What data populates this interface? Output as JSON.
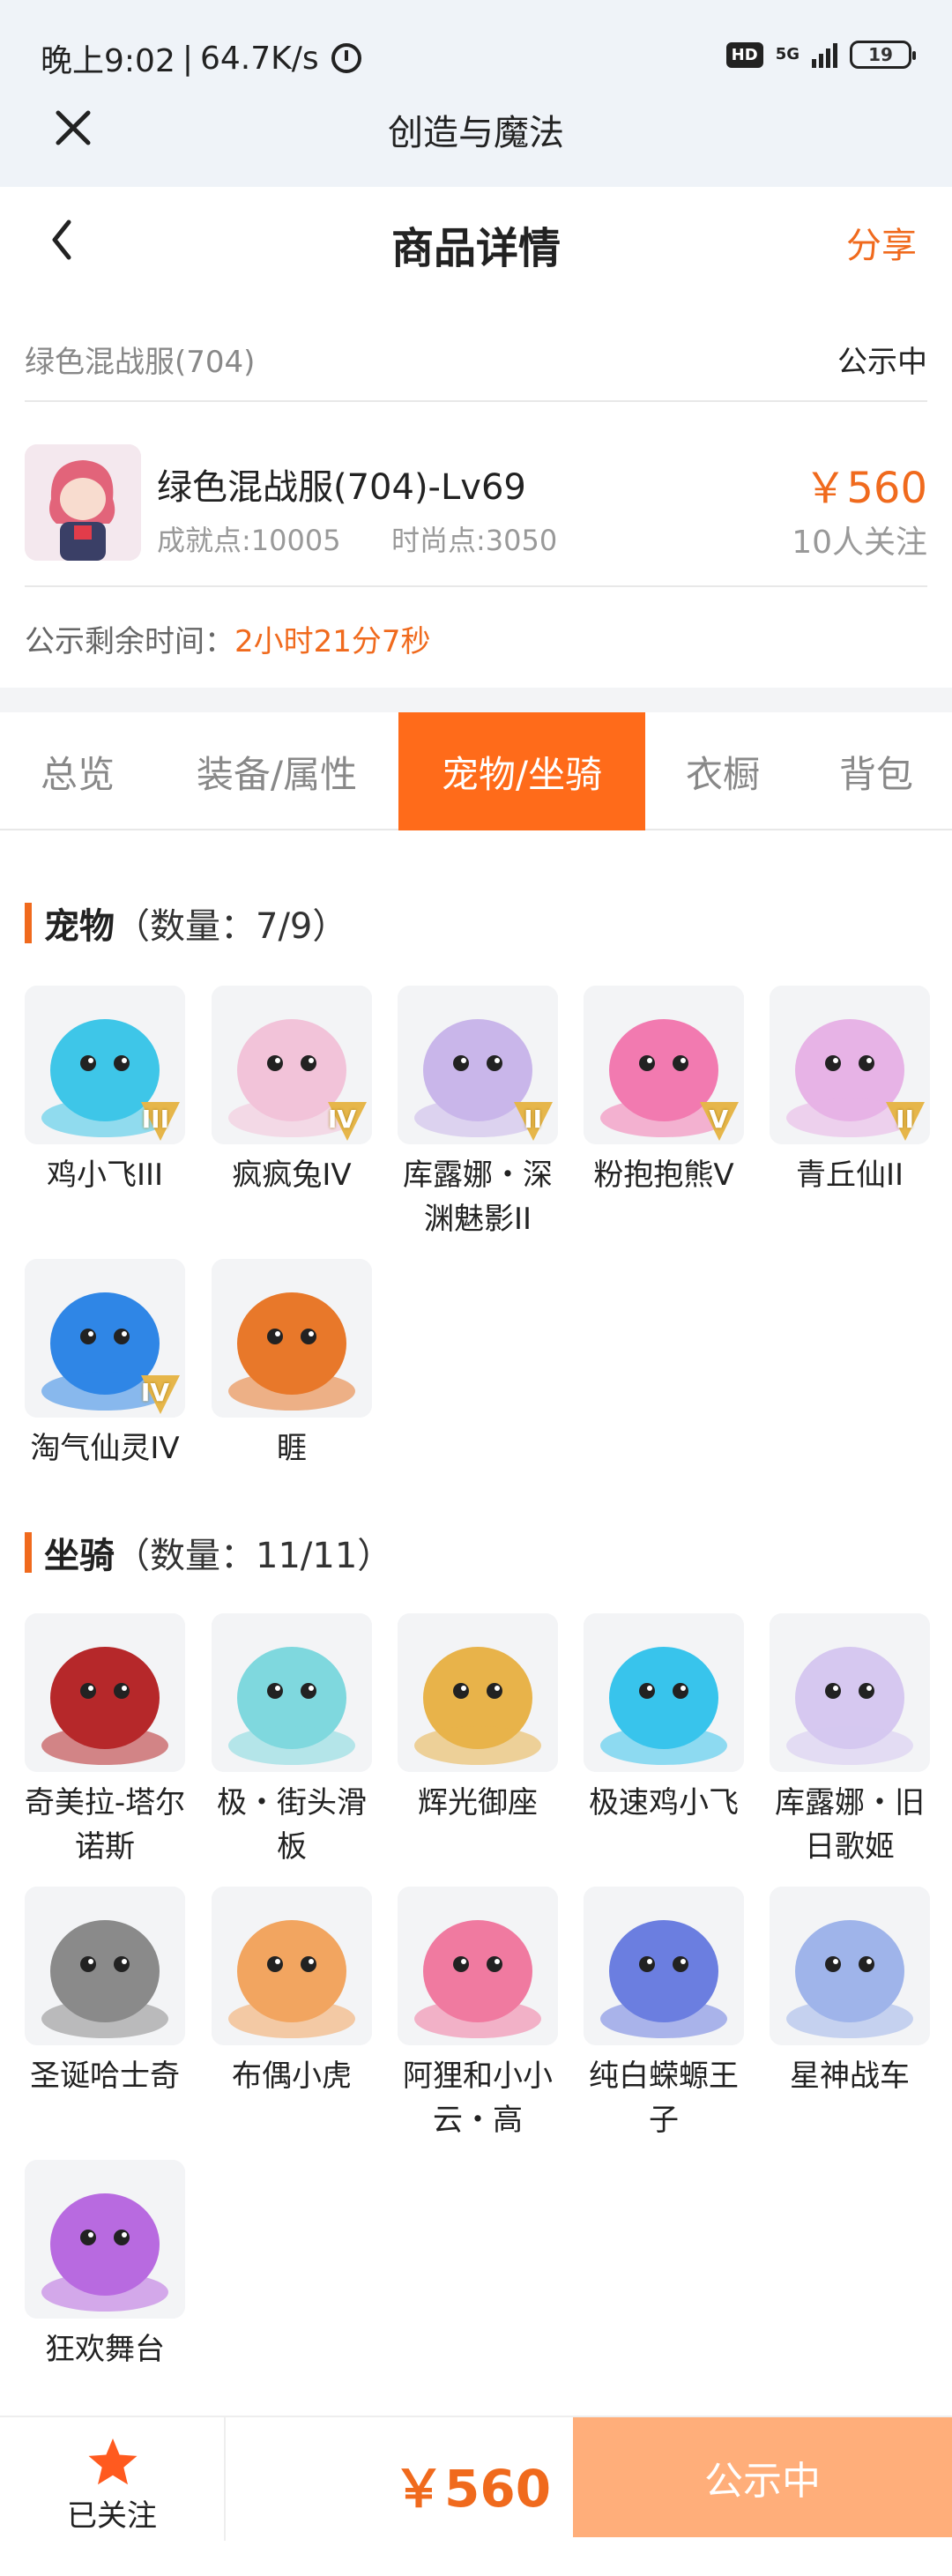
{
  "status_bar": {
    "time": "晚上9:02",
    "speed": "64.7K/s",
    "hd": "HD",
    "network": "5G",
    "battery": "19"
  },
  "app_bar": {
    "title": "创造与魔法"
  },
  "header": {
    "title": "商品详情",
    "share": "分享"
  },
  "server": {
    "name": "绿色混战服(704)",
    "status": "公示中"
  },
  "product": {
    "name": "绿色混战服(704)-Lv69",
    "achievement": "成就点:10005",
    "fashion": "时尚点:3050",
    "price": "￥560",
    "followers": "10人关注"
  },
  "countdown": {
    "label": "公示剩余时间：",
    "value": "2小时21分7秒"
  },
  "tabs": [
    {
      "label": "总览"
    },
    {
      "label": "装备/属性"
    },
    {
      "label": "宠物/坐骑"
    },
    {
      "label": "衣橱"
    },
    {
      "label": "背包"
    }
  ],
  "pets": {
    "title": "宠物",
    "count": "（数量：7/9）",
    "items": [
      {
        "name": "鸡小飞III",
        "icon": "blue-chick-icon",
        "tier": "III",
        "color": "#3ec6e8"
      },
      {
        "name": "疯疯兔IV",
        "icon": "crazy-rabbit-icon",
        "tier": "IV",
        "color": "#f2c3d9"
      },
      {
        "name": "库露娜・深渊魅影II",
        "icon": "kuluna-icon",
        "tier": "II",
        "color": "#c9b6ea"
      },
      {
        "name": "粉抱抱熊Ⅴ",
        "icon": "pink-bear-icon",
        "tier": "V",
        "color": "#f27ab0"
      },
      {
        "name": "青丘仙II",
        "icon": "fox-fairy-icon",
        "tier": "II",
        "color": "#e7b3e6"
      },
      {
        "name": "淘气仙灵IV",
        "icon": "blue-spirit-icon",
        "tier": "IV",
        "color": "#2f86e6"
      },
      {
        "name": "睚",
        "icon": "dragon-icon",
        "tier": "",
        "color": "#e8782a"
      }
    ]
  },
  "mounts": {
    "title": "坐骑",
    "count": "（数量：11/11）",
    "items": [
      {
        "name": "奇美拉-塔尔诺斯",
        "icon": "chimera-icon",
        "color": "#b6282a"
      },
      {
        "name": "极・街头滑板",
        "icon": "skateboard-icon",
        "color": "#7fd8de"
      },
      {
        "name": "辉光御座",
        "icon": "golden-throne-icon",
        "color": "#e8b34a"
      },
      {
        "name": "极速鸡小飞",
        "icon": "speed-chick-icon",
        "color": "#38c4ec"
      },
      {
        "name": "库露娜・旧日歌姬",
        "icon": "kuluna-singer-icon",
        "color": "#d6c8f0"
      },
      {
        "name": "圣诞哈士奇",
        "icon": "husky-icon",
        "color": "#8a8a8a"
      },
      {
        "name": "布偶小虎",
        "icon": "rag-tiger-icon",
        "color": "#f2a560"
      },
      {
        "name": "阿狸和小小云・高",
        "icon": "ali-cloud-icon",
        "color": "#f07aa0"
      },
      {
        "name": "纯白蝾螈王子",
        "icon": "axolotl-icon",
        "color": "#6b7ee0"
      },
      {
        "name": "星神战车",
        "icon": "star-chariot-icon",
        "color": "#9fb4ea"
      },
      {
        "name": "狂欢舞台",
        "icon": "carnival-stage-icon",
        "color": "#b86ae0"
      }
    ]
  },
  "bottom": {
    "follow_label": "已关注",
    "price": "￥560",
    "action": "公示中"
  },
  "colors": {
    "accent": "#f06a1d",
    "tab_active": "#ff6b1a",
    "action_button": "#ffae7a"
  }
}
